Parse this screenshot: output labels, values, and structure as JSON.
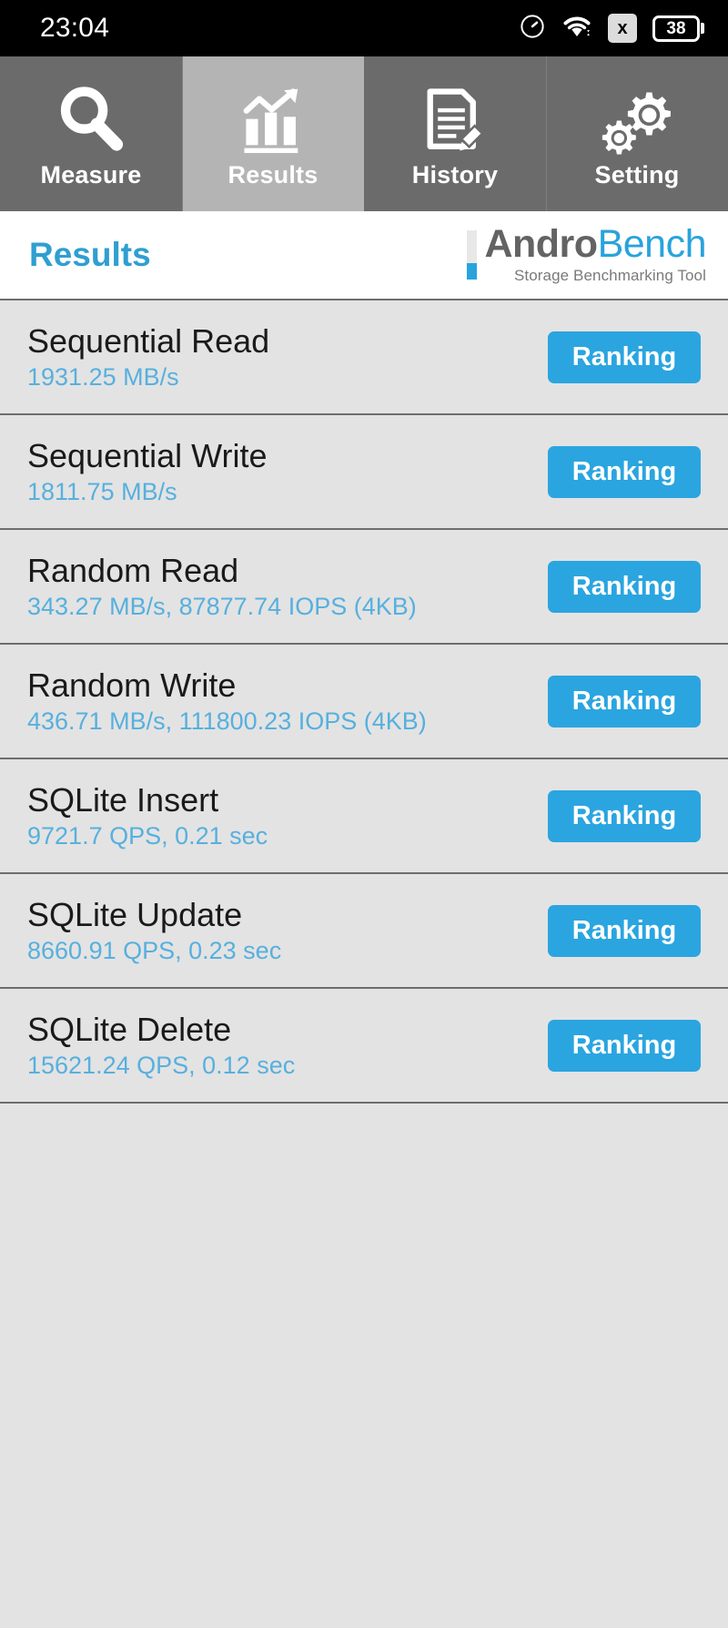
{
  "statusbar": {
    "time": "23:04",
    "icons": [
      {
        "name": "speedometer-icon"
      },
      {
        "name": "wifi-icon"
      },
      {
        "name": "sim-x-icon",
        "label": "x"
      },
      {
        "name": "battery-icon",
        "level": "38"
      }
    ]
  },
  "tabs": [
    {
      "label": "Measure",
      "icon": "magnifier-icon",
      "active": false
    },
    {
      "label": "Results",
      "icon": "bar-chart-trend-icon",
      "active": true
    },
    {
      "label": "History",
      "icon": "document-pencil-icon",
      "active": false
    },
    {
      "label": "Setting",
      "icon": "gears-icon",
      "active": false
    }
  ],
  "header": {
    "page_title": "Results",
    "brand_first": "Andro",
    "brand_second": "Bench",
    "brand_tagline": "Storage Benchmarking Tool"
  },
  "results": {
    "button_label": "Ranking",
    "rows": [
      {
        "title": "Sequential Read",
        "value": "1931.25 MB/s"
      },
      {
        "title": "Sequential Write",
        "value": "1811.75 MB/s"
      },
      {
        "title": "Random Read",
        "value": "343.27 MB/s, 87877.74 IOPS (4KB)"
      },
      {
        "title": "Random Write",
        "value": "436.71 MB/s, 111800.23 IOPS (4KB)"
      },
      {
        "title": "SQLite Insert",
        "value": "9721.7 QPS, 0.21 sec"
      },
      {
        "title": "SQLite Update",
        "value": "8660.91 QPS, 0.23 sec"
      },
      {
        "title": "SQLite Delete",
        "value": "15621.24 QPS, 0.12 sec"
      }
    ]
  },
  "colors": {
    "accent_blue": "#2aa5e0",
    "value_blue": "#57b0de",
    "title_blue": "#2f9fd0",
    "tab_inactive": "#6b6b6b",
    "tab_active": "#b4b4b4",
    "list_bg": "#e3e3e3"
  }
}
